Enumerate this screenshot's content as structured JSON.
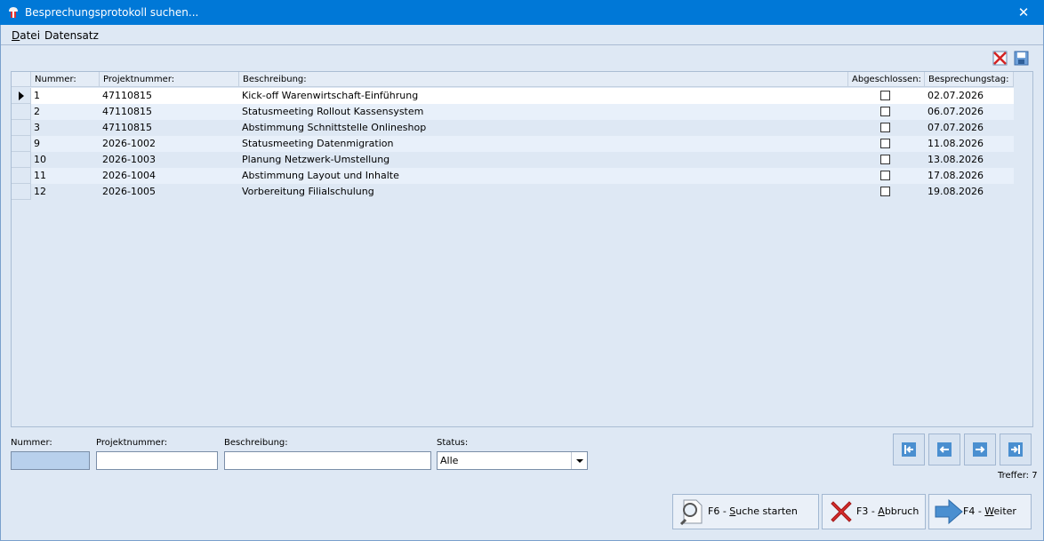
{
  "window": {
    "title": "Besprechungsprotokoll suchen...",
    "close_glyph": "✕"
  },
  "menu": [
    {
      "label": "Datei"
    },
    {
      "label": "Datensatz"
    }
  ],
  "toolbar": {
    "icons": [
      "delete-icon",
      "save-icon"
    ]
  },
  "grid": {
    "columns": [
      "Nummer:",
      "Projektnummer:",
      "Beschreibung:",
      "Abgeschlossen:",
      "Besprechungstag:"
    ],
    "rows": [
      {
        "nummer": "1",
        "projekt": "47110815",
        "beschreibung": "Kick-off Warenwirtschaft-Einführung",
        "abgeschlossen": false,
        "tag": "02.07.2026",
        "current": true
      },
      {
        "nummer": "2",
        "projekt": "47110815",
        "beschreibung": "Statusmeeting Rollout Kassensystem",
        "abgeschlossen": false,
        "tag": "06.07.2026"
      },
      {
        "nummer": "3",
        "projekt": "47110815",
        "beschreibung": "Abstimmung Schnittstelle Onlineshop",
        "abgeschlossen": false,
        "tag": "07.07.2026"
      },
      {
        "nummer": "9",
        "projekt": "2026-1002",
        "beschreibung": "Statusmeeting Datenmigration",
        "abgeschlossen": false,
        "tag": "11.08.2026"
      },
      {
        "nummer": "10",
        "projekt": "2026-1003",
        "beschreibung": "Planung Netzwerk-Umstellung",
        "abgeschlossen": false,
        "tag": "13.08.2026"
      },
      {
        "nummer": "11",
        "projekt": "2026-1004",
        "beschreibung": "Abstimmung Layout und Inhalte",
        "abgeschlossen": false,
        "tag": "17.08.2026"
      },
      {
        "nummer": "12",
        "projekt": "2026-1005",
        "beschreibung": "Vorbereitung Filialschulung",
        "abgeschlossen": false,
        "tag": "19.08.2026"
      }
    ]
  },
  "filters": {
    "nummer": {
      "label": "Nummer:",
      "value": ""
    },
    "projektnummer": {
      "label": "Projektnummer:",
      "value": ""
    },
    "beschreibung": {
      "label": "Beschreibung:",
      "value": ""
    },
    "status": {
      "label": "Status:",
      "value": "Alle"
    }
  },
  "navigation": {
    "icons": [
      "first-record-icon",
      "previous-record-icon",
      "next-record-icon",
      "last-record-icon"
    ],
    "treffer": "Treffer: 7"
  },
  "buttons": {
    "search": {
      "prefix": "F6 - ",
      "accel": "S",
      "rest": "uche starten"
    },
    "cancel": {
      "prefix": "F3 - ",
      "accel": "A",
      "rest": "bbruch"
    },
    "next": {
      "prefix": "F4 - ",
      "accel": "W",
      "rest": "eiter"
    }
  },
  "colors": {
    "titlebar": "#0078d7",
    "window_bg": "#dee8f4",
    "row_alt": "#e8f0fa",
    "accent_arrow": "#4a8fd0"
  }
}
